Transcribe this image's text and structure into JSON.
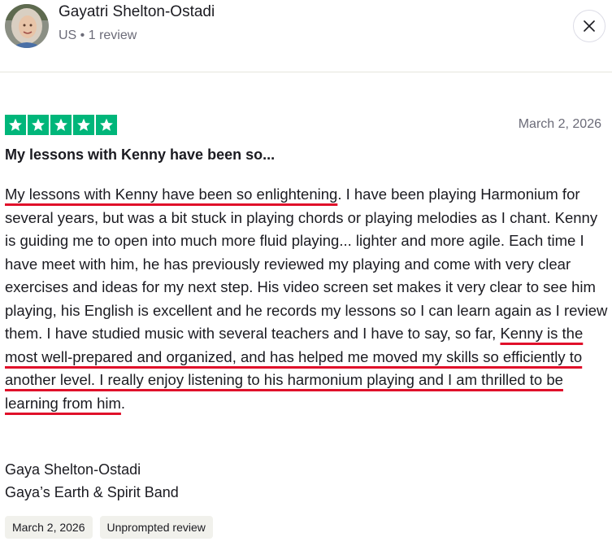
{
  "reviewer": {
    "name": "Gayatri Shelton-Ostadi",
    "meta": "US • 1 review",
    "avatar": "avatar-photo"
  },
  "close_icon": "close-icon",
  "review": {
    "rating": 5,
    "rating_max": 5,
    "star_color": "#00b67a",
    "date": "March 2, 2026",
    "title": "My lessons with Kenny have been so...",
    "body_segments": [
      "My lessons with Kenny have been so enlightening",
      ". I have been playing Harmonium for several years, but was a bit stuck in playing chords or playing melodies as I chant. Kenny is guiding me to open into much more fluid playing... lighter and more agile. Each time I have meet with him, he has previously reviewed my playing and come with very clear exercises and ideas for my next step. His video screen set makes it very clear to see him playing, his English is excellent and he records my lessons so I can learn again as I review them. I have studied music with several teachers and I have to say, so far, ",
      "Kenny is the most well-prepared and organized, and has helped me moved my skills so efficiently to another level. I really enjoy listening to his harmonium playing and I am thrilled to be learning from him",
      "."
    ],
    "highlight_color": "#e0102a",
    "signature": [
      "Gaya Shelton-Ostadi",
      "Gaya’s Earth & Spirit Band"
    ],
    "tags": [
      "March 2, 2026",
      "Unprompted review"
    ]
  }
}
